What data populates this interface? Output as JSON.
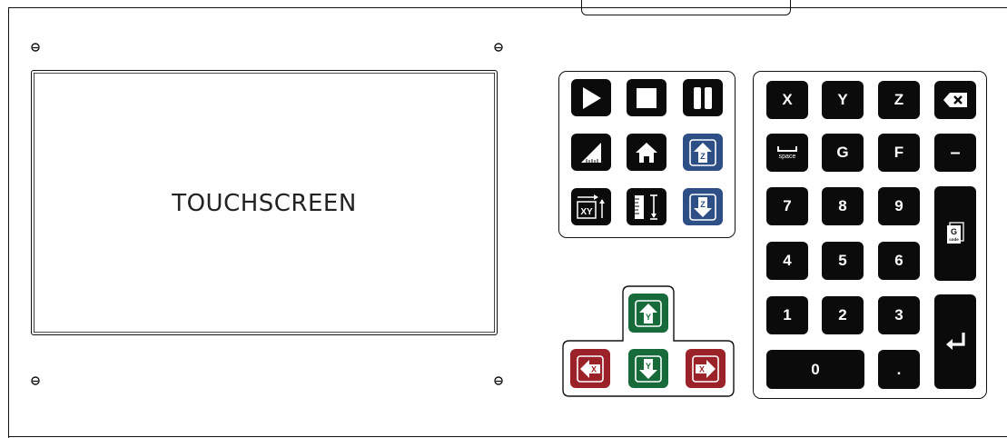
{
  "screen": {
    "label": "TOUCHSCREEN"
  },
  "control_panel": {
    "keys": [
      {
        "name": "play-button",
        "icon": "play-icon"
      },
      {
        "name": "stop-button",
        "icon": "stop-icon"
      },
      {
        "name": "pause-button",
        "icon": "pause-icon"
      },
      {
        "name": "measure-button",
        "icon": "ruler-triangle-icon"
      },
      {
        "name": "home-button",
        "icon": "home-icon"
      },
      {
        "name": "z-up-button",
        "icon": "z-up-icon",
        "label": "Z"
      },
      {
        "name": "xy-zero-button",
        "icon": "xy-zero-icon",
        "label": "XY"
      },
      {
        "name": "z-probe-button",
        "icon": "z-probe-icon"
      },
      {
        "name": "z-down-button",
        "icon": "z-down-icon",
        "label": "Z"
      }
    ]
  },
  "jog_panel": {
    "y_up": {
      "label": "Y",
      "icon": "arrow-up-icon"
    },
    "y_down": {
      "label": "Y",
      "icon": "arrow-down-icon"
    },
    "x_left": {
      "label": "X",
      "icon": "arrow-left-icon"
    },
    "x_right": {
      "label": "X",
      "icon": "arrow-right-icon"
    }
  },
  "keypad": {
    "x": "X",
    "y": "Y",
    "z": "Z",
    "backspace_icon": "backspace-icon",
    "space": "space",
    "g": "G",
    "f": "F",
    "minus": "–",
    "n7": "7",
    "n8": "8",
    "n9": "9",
    "n4": "4",
    "n5": "5",
    "n6": "6",
    "n1": "1",
    "n2": "2",
    "n3": "3",
    "n0": "0",
    "dot": ".",
    "gcode_top": "G",
    "gcode_bottom": "code",
    "enter_icon": "enter-icon"
  },
  "colors": {
    "blue": "#2d4f86",
    "green": "#176b3b",
    "red": "#9a2228",
    "key": "#0b0b0b"
  }
}
